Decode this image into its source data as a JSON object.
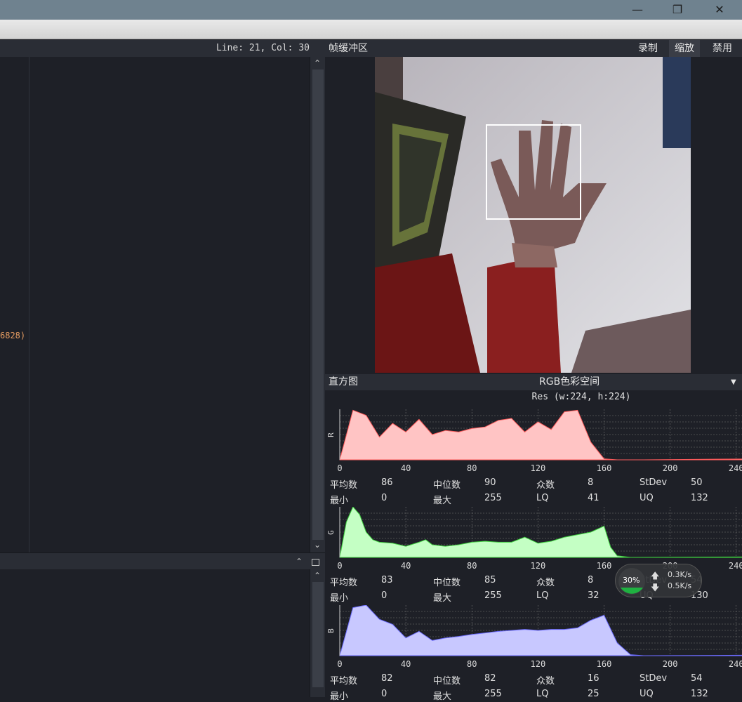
{
  "window": {
    "minimize_icon": "minimize-icon",
    "restore_icon": "restore-icon",
    "close_icon": "close-icon"
  },
  "editor": {
    "status": "Line: 21, Col: 30",
    "code_fragment": "6828)"
  },
  "framebuffer": {
    "title": "帧缓冲区",
    "record_label": "录制",
    "zoom_label": "缩放",
    "disable_label": "禁用"
  },
  "histogram": {
    "title": "直方图",
    "colorspace": "RGB色彩空间",
    "resolution": "Res (w:224, h:224)",
    "x_ticks": [
      "0",
      "40",
      "80",
      "120",
      "160",
      "200",
      "240"
    ],
    "labels": {
      "mean": "平均数",
      "median": "中位数",
      "mode": "众数",
      "stdev": "StDev",
      "min": "最小",
      "max": "最大",
      "lq": "LQ",
      "uq": "UQ"
    },
    "channels": [
      {
        "axis": "R",
        "mean": "86",
        "median": "90",
        "mode": "8",
        "stdev": "50",
        "min": "0",
        "max": "255",
        "lq": "41",
        "uq": "132",
        "color": "#ffc4c4",
        "line": "#ff5c5c"
      },
      {
        "axis": "G",
        "mean": "83",
        "median": "85",
        "mode": "8",
        "stdev": "54",
        "min": "0",
        "max": "255",
        "lq": "32",
        "uq": "130",
        "color": "#c4ffc4",
        "line": "#3fd13f"
      },
      {
        "axis": "B",
        "mean": "82",
        "median": "82",
        "mode": "16",
        "stdev": "54",
        "min": "0",
        "max": "255",
        "lq": "25",
        "uq": "132",
        "color": "#c8c8ff",
        "line": "#6c6cff"
      }
    ]
  },
  "network": {
    "cpu": "30%",
    "up": "0.3K/s",
    "down": "0.5K/s"
  },
  "chart_data": [
    {
      "type": "area",
      "ylabel": "R",
      "x": [
        0,
        8,
        16,
        24,
        32,
        40,
        48,
        56,
        64,
        72,
        80,
        88,
        96,
        104,
        112,
        120,
        128,
        136,
        144,
        152,
        160,
        168,
        176,
        184,
        255
      ],
      "values": [
        0,
        0.98,
        0.88,
        0.45,
        0.72,
        0.55,
        0.8,
        0.5,
        0.58,
        0.55,
        0.62,
        0.65,
        0.78,
        0.82,
        0.55,
        0.75,
        0.6,
        0.95,
        0.98,
        0.35,
        0.02,
        0,
        0,
        0,
        0.02
      ]
    },
    {
      "type": "area",
      "ylabel": "G",
      "x": [
        0,
        4,
        8,
        12,
        16,
        20,
        24,
        32,
        40,
        48,
        52,
        56,
        64,
        72,
        80,
        88,
        96,
        104,
        112,
        120,
        128,
        136,
        144,
        152,
        160,
        164,
        168,
        176,
        255
      ],
      "values": [
        0,
        0.7,
        1,
        0.85,
        0.5,
        0.35,
        0.3,
        0.28,
        0.22,
        0.3,
        0.35,
        0.25,
        0.22,
        0.25,
        0.3,
        0.32,
        0.3,
        0.3,
        0.4,
        0.28,
        0.32,
        0.4,
        0.45,
        0.5,
        0.62,
        0.2,
        0.03,
        0,
        0.01
      ]
    },
    {
      "type": "area",
      "ylabel": "B",
      "x": [
        0,
        8,
        16,
        24,
        32,
        40,
        48,
        56,
        64,
        72,
        80,
        88,
        96,
        104,
        112,
        120,
        128,
        136,
        144,
        152,
        160,
        168,
        176,
        184,
        255
      ],
      "values": [
        0,
        0.95,
        1,
        0.72,
        0.62,
        0.35,
        0.48,
        0.3,
        0.35,
        0.38,
        0.42,
        0.45,
        0.48,
        0.5,
        0.52,
        0.5,
        0.52,
        0.52,
        0.55,
        0.7,
        0.8,
        0.25,
        0.02,
        0,
        0.01
      ]
    }
  ]
}
